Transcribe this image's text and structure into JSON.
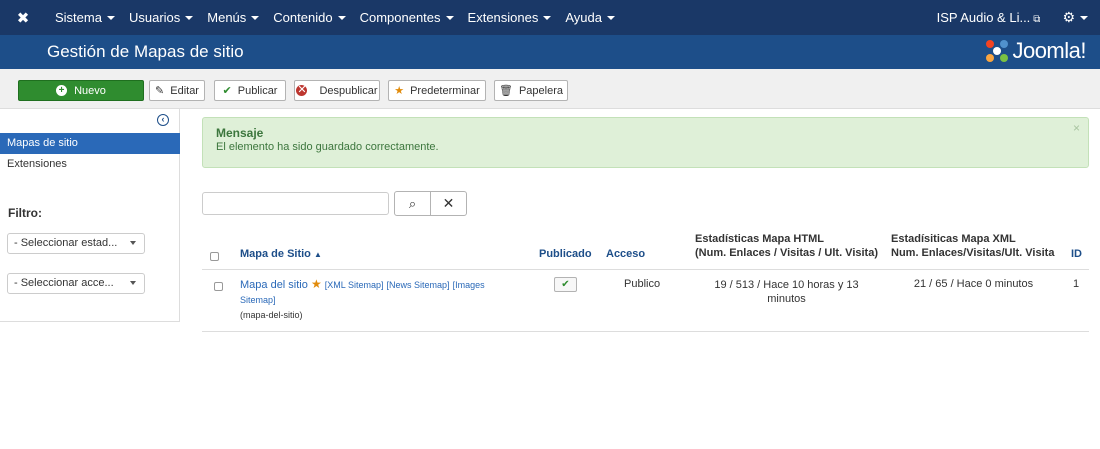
{
  "topnav": {
    "logo_icon": "joomla-icon",
    "menu": [
      {
        "label": "Sistema"
      },
      {
        "label": "Usuarios"
      },
      {
        "label": "Menús"
      },
      {
        "label": "Contenido"
      },
      {
        "label": "Componentes"
      },
      {
        "label": "Extensiones"
      },
      {
        "label": "Ayuda"
      }
    ],
    "site_label": "ISP Audio & Li...",
    "settings_icon": "gear-icon"
  },
  "header": {
    "title": "Gestión de Mapas de sitio",
    "brand": "Joomla!"
  },
  "toolbar": {
    "new_label": "Nuevo",
    "edit_label": "Editar",
    "publish_label": "Publicar",
    "unpublish_label": "Despublicar",
    "default_label": "Predeterminar",
    "trash_label": "Papelera"
  },
  "sidebar": {
    "items": [
      {
        "label": "Mapas de sitio",
        "active": true
      },
      {
        "label": "Extensiones",
        "active": false
      }
    ],
    "filter_label": "Filtro:",
    "status_select": "- Seleccionar estad...",
    "access_select": "- Seleccionar acce..."
  },
  "alert": {
    "heading": "Mensaje",
    "message": "El elemento ha sido guardado correctamente.",
    "close": "×"
  },
  "search": {
    "value": "",
    "placeholder": ""
  },
  "table": {
    "headers": {
      "name": "Mapa de Sitio",
      "published": "Publicado",
      "access": "Acceso",
      "html_stats_1": "Estadísticas Mapa HTML",
      "html_stats_2": "(Num. Enlaces / Visitas / Ult. Visita)",
      "xml_stats_1": "Estadísiticas Mapa XML",
      "xml_stats_2": "Num. Enlaces/Visitas/Ult. Visita",
      "id": "ID"
    },
    "rows": [
      {
        "name": "Mapa del sitio",
        "link_xml": "[XML Sitemap]",
        "link_news": "[News Sitemap]",
        "link_images_1": "[Images",
        "link_images_2": "Sitemap]",
        "alias": "(mapa-del-sitio)",
        "access": "Publico",
        "html_stats_1": "19 / 513 / Hace 10 horas y 13",
        "html_stats_2": "minutos",
        "xml_stats": "21 / 65 / Hace 0 minutos",
        "id": "1"
      }
    ]
  },
  "colors": {
    "topnav": "#1a3867",
    "header": "#1d4e89",
    "accent": "#2a69b8",
    "success": "#2f8c2f",
    "alert_bg": "#dff0d8"
  }
}
